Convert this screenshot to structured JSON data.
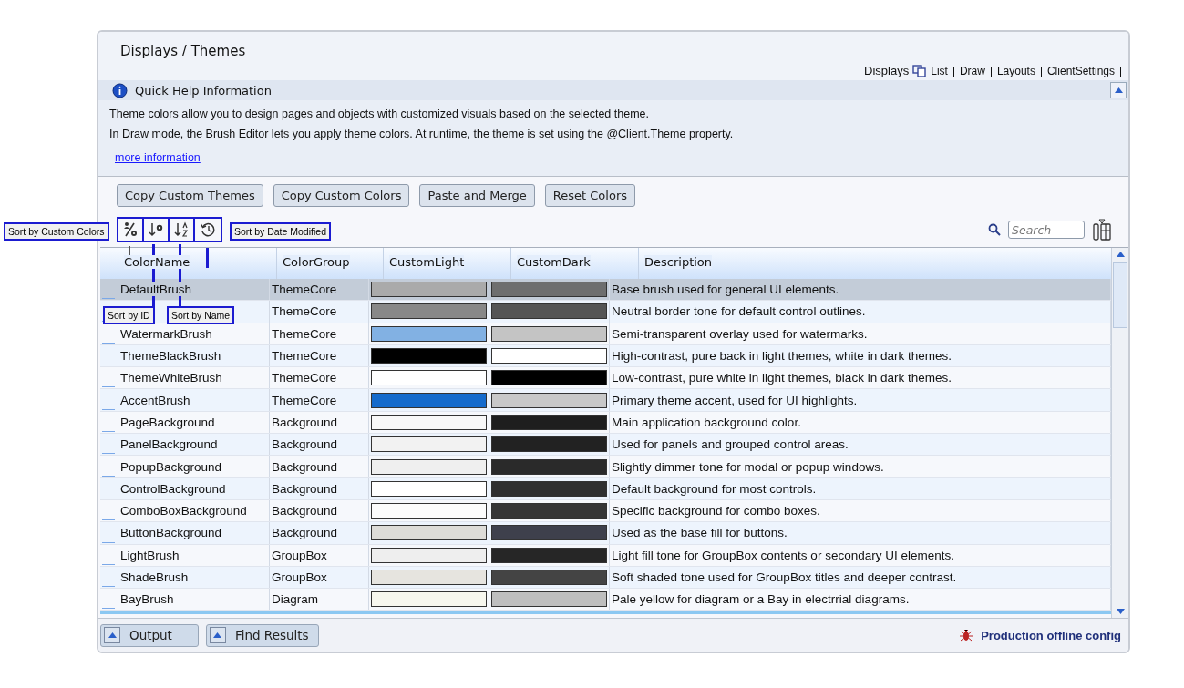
{
  "window": {
    "title": "Displays / Themes"
  },
  "nav": {
    "label": "Displays",
    "links": [
      "List",
      "Draw",
      "Layouts",
      "ClientSettings"
    ]
  },
  "help": {
    "title": "Quick Help Information",
    "expanded": true,
    "lines": [
      "Theme colors allow you to design pages and objects with customized visuals based on the selected theme.",
      "In Draw mode, the Brush Editor lets you apply theme colors. At runtime, the theme is set using the @Client.Theme property."
    ],
    "link": "more information"
  },
  "buttons": [
    "Copy Custom Themes",
    "Copy Custom Colors",
    "Paste and Merge",
    "Reset Colors"
  ],
  "tooltips": [
    {
      "label": "Sort by Custom Colors"
    },
    {
      "label": "Sort by ID"
    },
    {
      "label": "Sort by Name"
    },
    {
      "label": "Sort by Date Modified"
    }
  ],
  "search": {
    "placeholder": "Search"
  },
  "table": {
    "columns": [
      "ColorName",
      "ColorGroup",
      "CustomLight",
      "CustomDark",
      "Description"
    ],
    "rows": [
      {
        "name": "DefaultBrush",
        "group": "ThemeCore",
        "swatches": [
          {
            "color": "#aaaaaa"
          },
          {
            "color": "#6e6e6e"
          }
        ],
        "description": "Base brush used for general UI elements.",
        "selected": true
      },
      {
        "group": "ThemeCore",
        "swatches": [
          {
            "color": "#888888"
          },
          {
            "color": "#555555"
          }
        ],
        "description": "Neutral border tone for default control outlines.",
        "selected": false
      },
      {
        "name": "WatermarkBrush",
        "group": "ThemeCore",
        "swatches": [
          {
            "color": "#82b1e3"
          },
          {
            "color": "#c4c4c4"
          }
        ],
        "description": "Semi-transparent overlay used for watermarks.",
        "selected": false
      },
      {
        "name": "ThemeBlackBrush",
        "group": "ThemeCore",
        "swatches": [
          {
            "color": "#000000"
          },
          {
            "color": "#ffffff"
          }
        ],
        "description": "High-contrast, pure back in light themes, white in dark themes.",
        "selected": false
      },
      {
        "name": "ThemeWhiteBrush",
        "group": "ThemeCore",
        "swatches": [
          {
            "color": "#ffffff"
          },
          {
            "color": "#000000"
          }
        ],
        "description": "Low-contrast, pure white in light themes, black in dark themes.",
        "selected": false
      },
      {
        "name": "AccentBrush",
        "group": "ThemeCore",
        "swatches": [
          {
            "color": "#156bcc"
          },
          {
            "color": "#c8c8c8"
          }
        ],
        "description": "Primary theme accent, used for UI highlights.",
        "selected": false
      },
      {
        "name": "PageBackground",
        "group": "Background",
        "swatches": [
          {
            "color": "#f8f8f8"
          },
          {
            "color": "#1e1e1e"
          }
        ],
        "description": "Main application background color.",
        "selected": false
      },
      {
        "name": "PanelBackground",
        "group": "Background",
        "swatches": [
          {
            "color": "#f2f2f2"
          },
          {
            "color": "#222222"
          }
        ],
        "description": "Used for panels and grouped control areas.",
        "selected": false
      },
      {
        "name": "PopupBackground",
        "group": "Background",
        "swatches": [
          {
            "color": "#efefef"
          },
          {
            "color": "#2a2a2a"
          }
        ],
        "description": "Slightly dimmer tone for modal or popup windows.",
        "selected": false
      },
      {
        "name": "ControlBackground",
        "group": "Background",
        "swatches": [
          {
            "color": "#ffffff"
          },
          {
            "color": "#303030"
          }
        ],
        "description": "Default background for most controls.",
        "selected": false
      },
      {
        "name": "ComboBoxBackground",
        "group": "Background",
        "swatches": [
          {
            "color": "#fcfcfc"
          },
          {
            "color": "#363636"
          }
        ],
        "description": "Specific background for combo boxes.",
        "selected": false
      },
      {
        "name": "ButtonBackground",
        "group": "Background",
        "swatches": [
          {
            "color": "#dddcd8"
          },
          {
            "color": "#3e404c"
          }
        ],
        "description": "Used as the base fill for buttons.",
        "selected": false
      },
      {
        "name": "LightBrush",
        "group": "GroupBox",
        "swatches": [
          {
            "color": "#eeeeee"
          },
          {
            "color": "#262626"
          }
        ],
        "description": "Light fill tone for GroupBox contents or secondary UI elements.",
        "selected": false
      },
      {
        "name": "ShadeBrush",
        "group": "GroupBox",
        "swatches": [
          {
            "color": "#e6e4df"
          },
          {
            "color": "#444444"
          }
        ],
        "description": "Soft shaded tone used for GroupBox titles and deeper contrast.",
        "selected": false
      },
      {
        "name": "BayBrush",
        "group": "Diagram",
        "swatches": [
          {
            "color": "#f7f7ee"
          },
          {
            "color": "#bebebe"
          }
        ],
        "description": "Pale yellow for diagram or a Bay in electrrial diagrams.",
        "selected": false
      }
    ]
  },
  "bottom_tabs": [
    "Output",
    "Find Results"
  ],
  "status": "Production offline config"
}
